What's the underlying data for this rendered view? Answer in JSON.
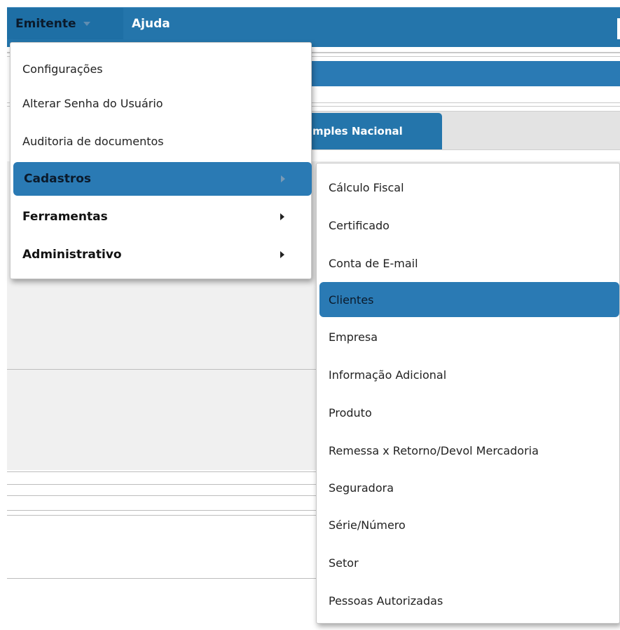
{
  "menubar": {
    "emitente_label": "Emitente",
    "ajuda_label": "Ajuda"
  },
  "background": {
    "tab_label": "mples Nacional"
  },
  "dropdown": {
    "items": [
      {
        "label": "Configurações",
        "has_submenu": false
      },
      {
        "label": "Alterar Senha do Usuário",
        "has_submenu": false
      },
      {
        "label": "Auditoria de documentos",
        "has_submenu": false
      },
      {
        "label": "Cadastros",
        "has_submenu": true,
        "active": true
      },
      {
        "label": "Ferramentas",
        "has_submenu": true
      },
      {
        "label": "Administrativo",
        "has_submenu": true
      }
    ]
  },
  "submenu": {
    "items": [
      {
        "label": "Cálculo Fiscal"
      },
      {
        "label": "Certificado"
      },
      {
        "label": "Conta de E-mail"
      },
      {
        "label": "Clientes",
        "active": true
      },
      {
        "label": "Empresa"
      },
      {
        "label": "Informação Adicional"
      },
      {
        "label": "Produto"
      },
      {
        "label": "Remessa x Retorno/Devol Mercadoria"
      },
      {
        "label": "Seguradora"
      },
      {
        "label": "Série/Número"
      },
      {
        "label": "Setor"
      },
      {
        "label": "Pessoas Autorizadas"
      }
    ]
  },
  "colors": {
    "accent": "#2475ab",
    "highlight": "#2a7ab4",
    "background_panel": "#f0f0f0"
  }
}
